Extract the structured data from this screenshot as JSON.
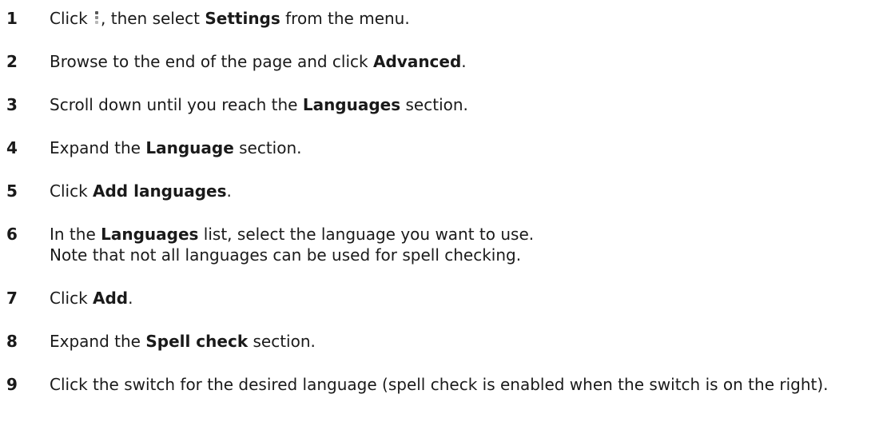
{
  "steps": [
    {
      "number": "1",
      "parts": [
        {
          "text": "Click "
        },
        {
          "icon": "more-vertical-icon"
        },
        {
          "text": ", then select "
        },
        {
          "bold": "Settings"
        },
        {
          "text": " from the menu."
        }
      ]
    },
    {
      "number": "2",
      "parts": [
        {
          "text": "Browse to the end of the page and click "
        },
        {
          "bold": "Advanced"
        },
        {
          "text": "."
        }
      ]
    },
    {
      "number": "3",
      "parts": [
        {
          "text": "Scroll down until you reach the "
        },
        {
          "bold": "Languages"
        },
        {
          "text": " section."
        }
      ]
    },
    {
      "number": "4",
      "parts": [
        {
          "text": "Expand the "
        },
        {
          "bold": "Language"
        },
        {
          "text": " section."
        }
      ]
    },
    {
      "number": "5",
      "parts": [
        {
          "text": "Click "
        },
        {
          "bold": "Add languages"
        },
        {
          "text": "."
        }
      ]
    },
    {
      "number": "6",
      "parts": [
        {
          "text": "In the "
        },
        {
          "bold": "Languages"
        },
        {
          "text": " list, select the language you want to use."
        },
        {
          "break": true
        },
        {
          "text": "Note that not all languages can be used for spell checking."
        }
      ]
    },
    {
      "number": "7",
      "parts": [
        {
          "text": "Click "
        },
        {
          "bold": "Add"
        },
        {
          "text": "."
        }
      ]
    },
    {
      "number": "8",
      "parts": [
        {
          "text": "Expand the "
        },
        {
          "bold": "Spell check"
        },
        {
          "text": " section."
        }
      ]
    },
    {
      "number": "9",
      "parts": [
        {
          "text": "Click the switch for the desired language (spell check is enabled when the switch is on the right)."
        }
      ]
    }
  ]
}
